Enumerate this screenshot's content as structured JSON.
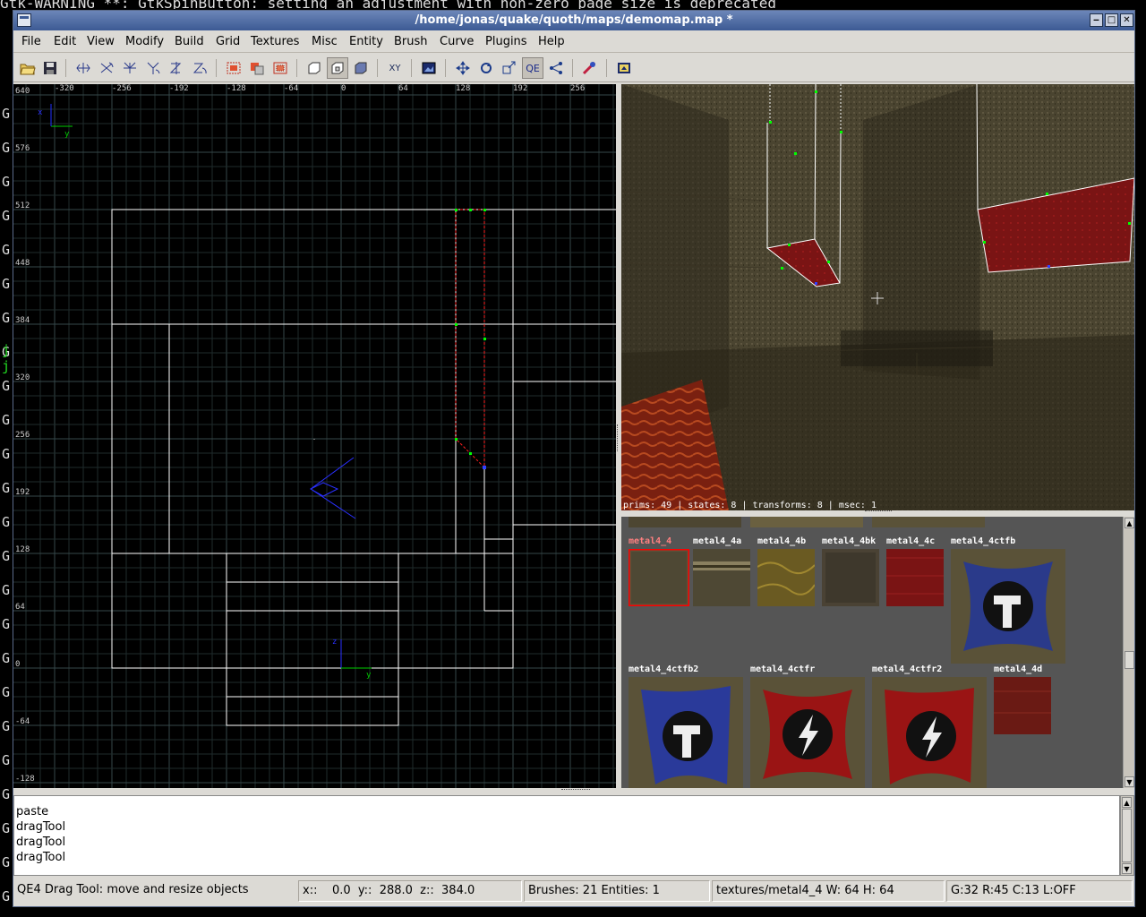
{
  "terminal": {
    "top_line": "Gtk-WARNING **: GtkSpinButton: setting an adjustment with non-zero page size is deprecated",
    "left_chars": [
      "G",
      "G",
      "G",
      "G",
      "G",
      "G",
      "G",
      "G",
      "j",
      "j",
      "G",
      "G",
      "G",
      "G",
      "G",
      "G",
      "G",
      "G",
      "G",
      "G",
      "G",
      "G",
      "G",
      "G",
      "G",
      "G"
    ]
  },
  "window": {
    "title": "/home/jonas/quake/quoth/maps/demomap.map *",
    "buttons": {
      "minimize": "‒",
      "maximize": "□",
      "close": "✕"
    }
  },
  "menu": [
    "File",
    "Edit",
    "View",
    "Modify",
    "Build",
    "Grid",
    "Textures",
    "Misc",
    "Entity",
    "Brush",
    "Curve",
    "Plugins",
    "Help"
  ],
  "toolbar": {
    "xy_flip_label": "XY",
    "qe_label": "QE"
  },
  "xy_view": {
    "ruler_x": [
      "-320",
      "-256",
      "-192",
      "-128",
      "-64",
      "0",
      "64",
      "128",
      "192",
      "256"
    ],
    "ruler_y": [
      "640",
      "576",
      "512",
      "448",
      "384",
      "320",
      "256",
      "192",
      "128",
      "64",
      "0",
      "-64",
      "-128"
    ],
    "axis_top": {
      "v": "x",
      "h": "y"
    },
    "axis_origin": {
      "v": "z",
      "h": "y"
    },
    "colors": {
      "grid": "#2a3a3a",
      "brush": "#ffffff",
      "selected": "#ff2020",
      "handle": "#00ff00",
      "camera": "#2222ff"
    }
  },
  "camera": {
    "stats": "prims: 49 | states: 8 | transforms: 8 | msec: 1"
  },
  "textures": {
    "row1": [
      "metal4_4",
      "metal4_4a",
      "metal4_4b",
      "metal4_4bk",
      "metal4_4c",
      "metal4_4ctfb"
    ],
    "row2": [
      "metal4_4ctfb2",
      "metal4_4ctfr",
      "metal4_4ctfr2",
      "metal4_4d"
    ],
    "selected": "metal4_4"
  },
  "console": {
    "lines": [
      "paste",
      "dragTool",
      "dragTool",
      "dragTool"
    ]
  },
  "status": {
    "tool": "QE4 Drag Tool: move and resize objects",
    "coords": "x::    0.0  y::  288.0  z::  384.0",
    "counts": "Brushes: 21 Entities: 1",
    "texture": "textures/metal4_4 W: 64 H: 64",
    "grid": "G:32  R:45  C:13  L:OFF"
  }
}
